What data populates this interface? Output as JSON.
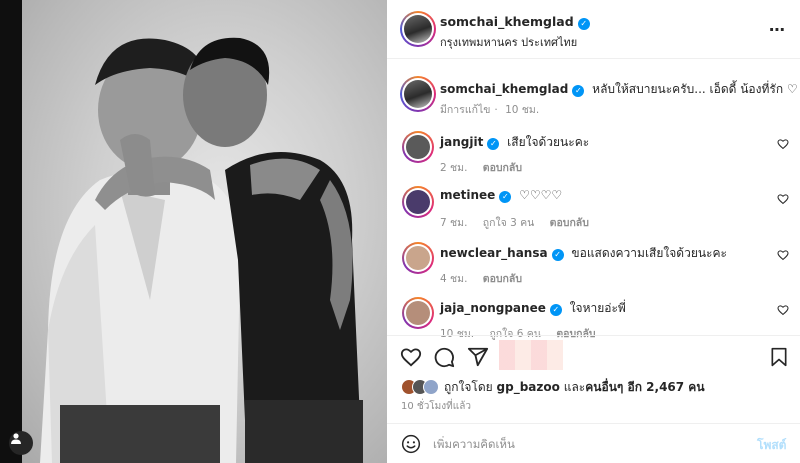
{
  "post": {
    "author": "somchai_khemglad",
    "location": "กรุงเทพมหานคร ประเทศไทย",
    "more_icon": "more-horizontal-icon"
  },
  "caption": {
    "username": "somchai_khemglad",
    "text": "หลับให้สบายนะครับ... เอ็ดดี้ น้องที่รัก ♡",
    "edited": "มีการแก้ไข",
    "time": "10 ชม."
  },
  "comments": [
    {
      "username": "jangjit",
      "text": "เสียใจด้วยนะคะ",
      "time": "2 ชม.",
      "likes": "",
      "reply": "ตอบกลับ",
      "avatar_color": "#5a5a5a"
    },
    {
      "username": "metinee",
      "text": "♡♡♡♡",
      "time": "7 ชม.",
      "likes": "ถูกใจ 3 คน",
      "reply": "ตอบกลับ",
      "avatar_color": "#4a3b6b"
    },
    {
      "username": "newclear_hansa",
      "text": "ขอแสดงความเสียใจด้วยนะคะ",
      "time": "4 ชม.",
      "likes": "",
      "reply": "ตอบกลับ",
      "avatar_color": "#c9a58c"
    },
    {
      "username": "jaja_nongpanee",
      "text": "ใจหายอ่ะพี่",
      "time": "10 ชม.",
      "likes": "ถูกใจ 6 คน",
      "reply": "ตอบกลับ",
      "avatar_color": "#b58e7a"
    }
  ],
  "likes": {
    "prefix": "ถูกใจโดย",
    "user": "gp_bazoo",
    "middle": "และ",
    "others": "คนอื่นๆ อีก 2,467 คน"
  },
  "time_ago": "10 ชั่วโมงที่แล้ว",
  "add_comment": {
    "placeholder": "เพิ่มความคิดเห็น",
    "post_label": "โพสต์"
  },
  "colors": {
    "verified": "#0095f6",
    "meta": "#8e8e8e",
    "post_disabled": "#b2dffc"
  }
}
